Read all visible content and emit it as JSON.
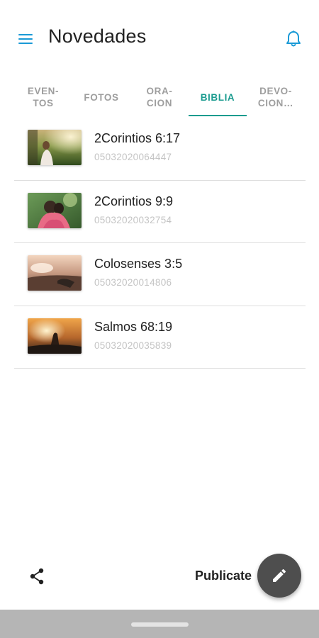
{
  "header": {
    "title": "Novedades",
    "menu_icon": "hamburger-menu-icon",
    "bell_icon": "bell-icon",
    "accent_color": "#1a9ad6"
  },
  "tabs": [
    {
      "label": "EVEN-\nTOS",
      "active": false
    },
    {
      "label": "FOTOS",
      "active": false
    },
    {
      "label": "ORA-\nCION",
      "active": false
    },
    {
      "label": "BIBLIA",
      "active": true
    },
    {
      "label": "DEVO-\nCION…",
      "active": false
    }
  ],
  "tab_active_color": "#1a9b8f",
  "items": [
    {
      "title": "2Corintios 6:17",
      "subtitle": "05032020064447",
      "thumb": "woman-in-sunlit-field-image"
    },
    {
      "title": "2Corintios 9:9",
      "subtitle": "05032020032754",
      "thumb": "people-hugging-image"
    },
    {
      "title": "Colosenses 3:5",
      "subtitle": "05032020014806",
      "thumb": "hand-at-sunset-image"
    },
    {
      "title": "Salmos 68:19",
      "subtitle": "05032020035839",
      "thumb": "hand-reaching-sun-image"
    }
  ],
  "bottom": {
    "publicate_label": "Publicate",
    "share_icon": "share-icon",
    "fab_icon": "pencil-icon",
    "fab_color": "#4e4e4e"
  }
}
